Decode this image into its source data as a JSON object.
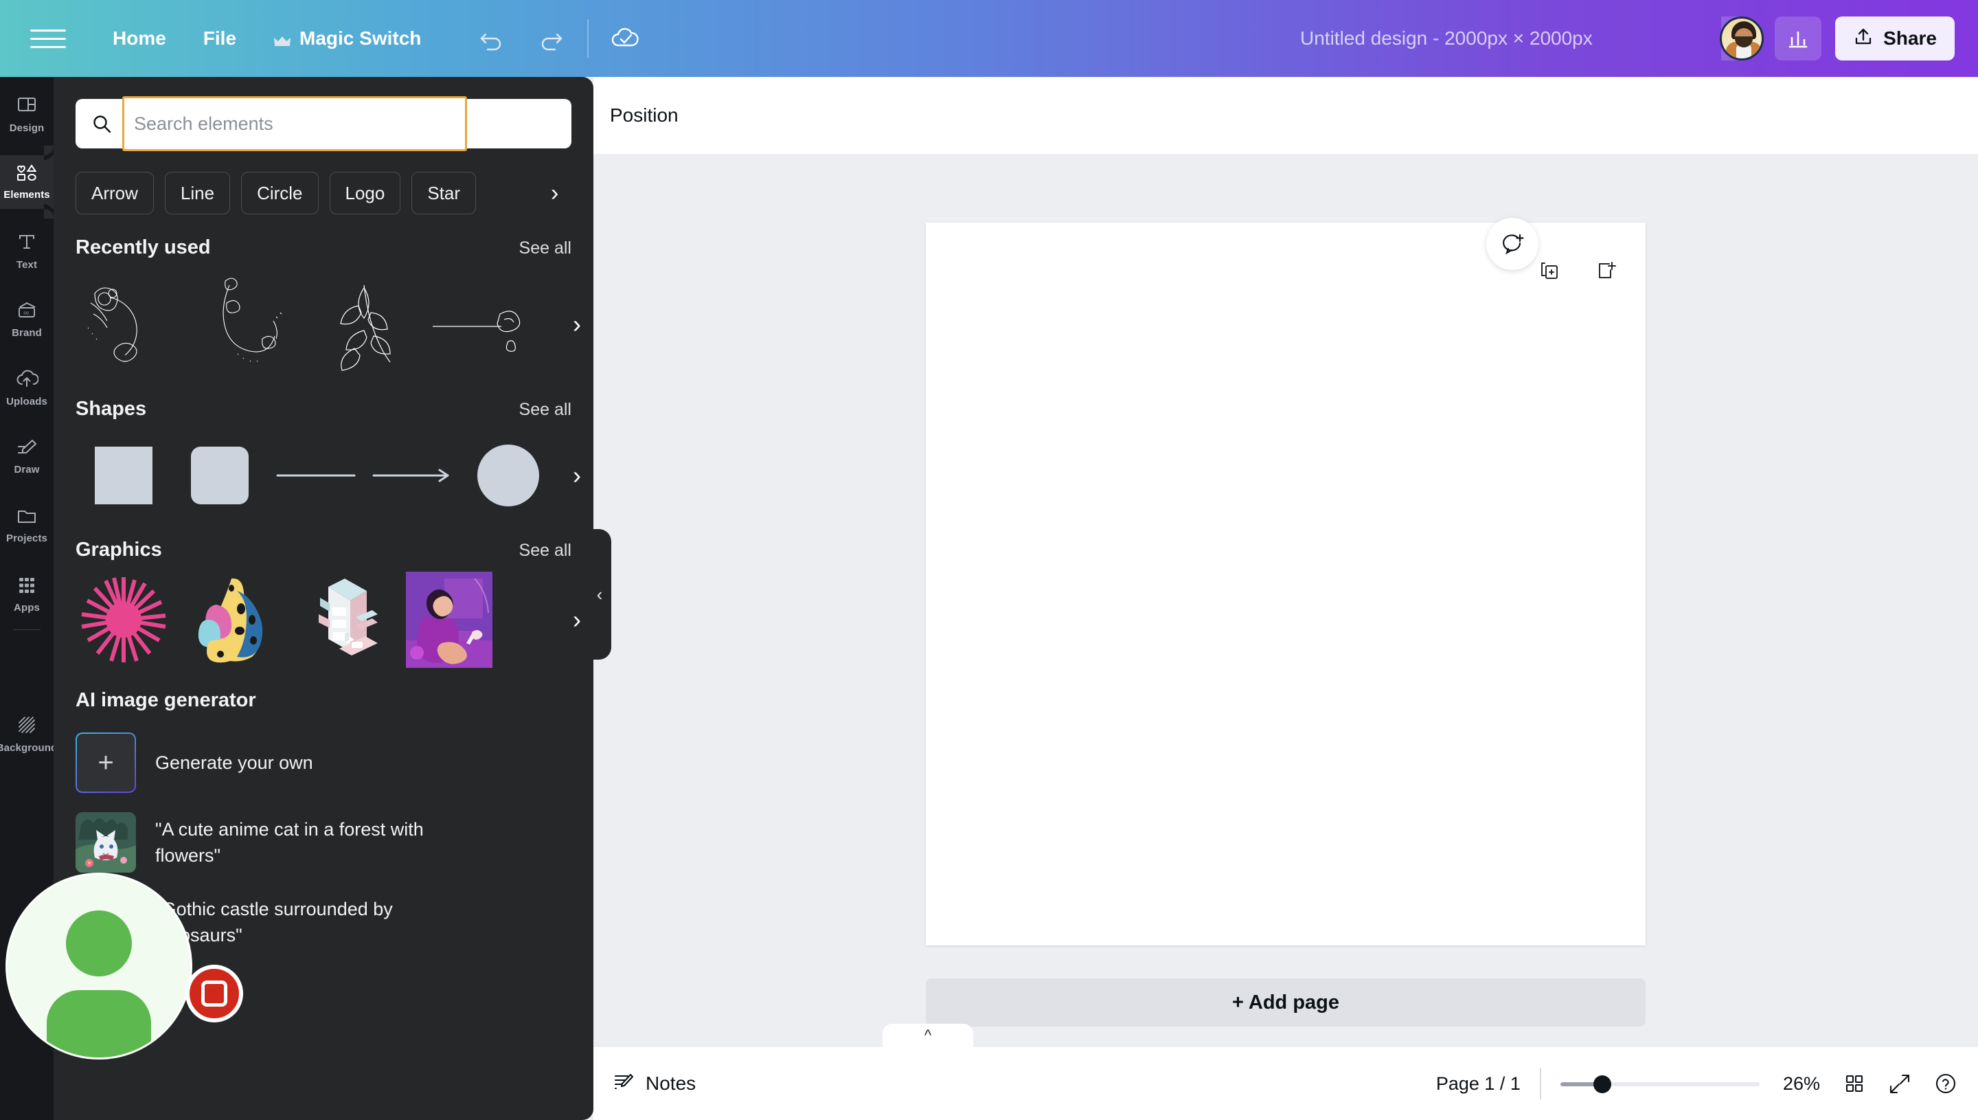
{
  "topbar": {
    "menu_icon": "hamburger-menu-icon",
    "nav": [
      {
        "label": "Home",
        "icon": null
      },
      {
        "label": "File",
        "icon": null
      },
      {
        "label": "Magic Switch",
        "icon": "crown-icon"
      }
    ],
    "undo_icon": "undo-icon",
    "redo_icon": "redo-icon",
    "saved_icon": "cloud-check-icon",
    "doc_title": "Untitled design - 2000px × 2000px",
    "avatar_name": "user-avatar",
    "add_collaborator_label": "+",
    "stats_icon": "bar-chart-icon",
    "share_label": "Share",
    "share_icon": "upload-icon"
  },
  "rail": {
    "items": [
      {
        "label": "Design",
        "icon": "layout-icon",
        "active": false
      },
      {
        "label": "Elements",
        "icon": "shapes-icon",
        "active": true
      },
      {
        "label": "Text",
        "icon": "text-t-icon",
        "active": false
      },
      {
        "label": "Brand",
        "icon": "brand-card-icon",
        "active": false
      },
      {
        "label": "Uploads",
        "icon": "cloud-upload-icon",
        "active": false
      },
      {
        "label": "Draw",
        "icon": "pen-draw-icon",
        "active": false
      },
      {
        "label": "Projects",
        "icon": "folder-icon",
        "active": false
      },
      {
        "label": "Apps",
        "icon": "grid-dots-icon",
        "active": false
      },
      {
        "label": "Background",
        "icon": "hatch-lines-icon",
        "active": false
      }
    ]
  },
  "panel": {
    "search": {
      "value": "",
      "placeholder": "Search elements",
      "icon": "search-icon",
      "focused": true
    },
    "chips": [
      "Arrow",
      "Line",
      "Circle",
      "Logo",
      "Star"
    ],
    "chips_next_icon": "chevron-right-icon",
    "sections": [
      {
        "title": "Recently used",
        "see_all": "See all",
        "next_icon": "chevron-right-icon",
        "items": [
          "floral-wreath-line-art",
          "floral-swirl-line-art",
          "leaf-branch-line-art",
          "rose-line-art"
        ]
      },
      {
        "title": "Shapes",
        "see_all": "See all",
        "next_icon": "chevron-right-icon",
        "items": [
          "square-shape",
          "rounded-square-shape",
          "line-shape",
          "arrow-shape",
          "circle-shape"
        ]
      },
      {
        "title": "Graphics",
        "see_all": "See all",
        "next_icon": "chevron-right-icon",
        "items": [
          "pink-starburst-graphic",
          "thumbs-up-graphic",
          "isometric-bookshelf-graphic",
          "purple-woman-illustration"
        ]
      }
    ],
    "ai": {
      "title": "AI image generator",
      "items": [
        {
          "label": "Generate your own",
          "thumb": "plus-tile"
        },
        {
          "label": "\"A cute anime cat in a forest with flowers\"",
          "thumb": "anime-cat-thumb"
        },
        {
          "label": "\"Gothic castle surrounded by dinosaurs\"",
          "thumb": "gothic-castle-thumb"
        }
      ]
    },
    "collapse_icon": "chevron-left-icon"
  },
  "editor": {
    "position_label": "Position",
    "duplicate_page_icon": "duplicate-page-icon",
    "add_page_icon": "add-page-icon",
    "comment_icon": "add-comment-icon",
    "add_page_label": "+ Add page",
    "ai_assistant_icon": "magic-sparkles-icon"
  },
  "bottombar": {
    "notes_label": "Notes",
    "notes_icon": "notes-pencil-icon",
    "page_indicator": "Page 1 / 1",
    "zoom_value": "26%",
    "zoom_percent": 26,
    "grid_view_icon": "grid-view-icon",
    "fullscreen_icon": "expand-fullscreen-icon",
    "help_icon": "help-question-icon",
    "collapse_icon": "chevron-up-icon"
  },
  "overlay": {
    "camera_bubble": "camera-bubble-avatar",
    "record_button": "stop-recording-button"
  },
  "colors": {
    "brand_start": "#5cc6c8",
    "brand_end": "#8338e0",
    "focus_ring": "#eaa63c",
    "record_red": "#d0291c",
    "avatar_green": "#5cb84f",
    "panel_bg": "#252729",
    "rail_bg": "#16181c"
  }
}
